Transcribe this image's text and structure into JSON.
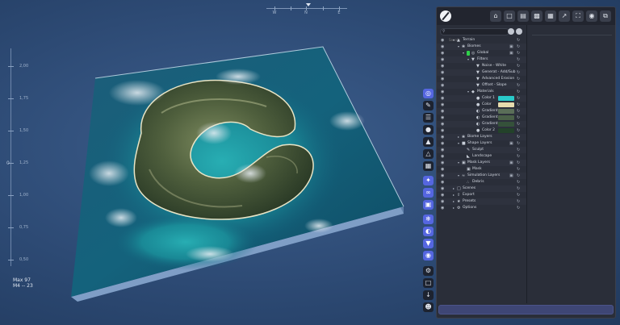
{
  "compass": {
    "labels": [
      "W",
      "N",
      "E"
    ]
  },
  "ruler": {
    "values": [
      "2,00",
      "1,75",
      "1,50",
      "1,25",
      "1,00",
      "0,75",
      "0,50"
    ],
    "zero_label": "0"
  },
  "readout": {
    "line1": "Max 97",
    "line2": "M4 -- 23"
  },
  "toolbar_left": {
    "icons": [
      "target-icon",
      "brush-icon",
      "layers-icon",
      "drop-icon",
      "mountain-icon",
      "terrain-icon",
      "grid-icon",
      "select-icon",
      "link-icon",
      "plugin-icon",
      "snow-icon",
      "globe-icon",
      "filter-icon",
      "database-icon",
      "gear-icon",
      "folder-icon",
      "download-icon",
      "people-icon"
    ]
  },
  "toolbar_top": {
    "icons": [
      "home-icon",
      "new-file-icon",
      "open-folder-icon",
      "save-icon",
      "save-as-icon",
      "export-icon",
      "fullscreen-icon",
      "camera-icon",
      "copy-icon"
    ]
  },
  "search": {
    "placeholder": "Search"
  },
  "tree": [
    {
      "label": "Terrain",
      "indent": 0,
      "caret": "v",
      "icon": "terrain-icon"
    },
    {
      "label": "Biomes",
      "indent": 1,
      "caret": "v",
      "icon": "biome-icon"
    },
    {
      "label": "Global",
      "indent": 2,
      "caret": "v",
      "icon": "global-icon",
      "flag": "#2fd14a"
    },
    {
      "label": "Filters",
      "indent": 3,
      "caret": "v",
      "icon": "filter-icon"
    },
    {
      "label": "Noise - White",
      "indent": 4,
      "caret": "",
      "icon": "filter-icon"
    },
    {
      "label": "Generat - Add/Sub",
      "indent": 4,
      "caret": "",
      "icon": "filter-icon"
    },
    {
      "label": "Advanced Erosion",
      "indent": 4,
      "caret": "",
      "icon": "filter-icon"
    },
    {
      "label": "Offset - Slope",
      "indent": 4,
      "caret": "",
      "icon": "filter-icon"
    },
    {
      "label": "Materials",
      "indent": 3,
      "caret": "v",
      "icon": "material-icon"
    },
    {
      "label": "Color 1",
      "indent": 4,
      "caret": "",
      "icon": "color-icon",
      "swatch": "#29c9c9"
    },
    {
      "label": "Color",
      "indent": 4,
      "caret": "",
      "icon": "color-icon",
      "swatch": "#e7dcae"
    },
    {
      "label": "Gradient",
      "indent": 4,
      "caret": "",
      "icon": "gradient-icon",
      "swatch": "#5a6e58"
    },
    {
      "label": "Gradient",
      "indent": 4,
      "caret": "",
      "icon": "gradient-icon",
      "swatch": "#4a6048"
    },
    {
      "label": "Gradient",
      "indent": 4,
      "caret": "",
      "icon": "gradient-icon",
      "swatch": "#35513a"
    },
    {
      "label": "Color 2",
      "indent": 4,
      "caret": "",
      "icon": "color-icon",
      "swatch": "#23422a"
    },
    {
      "label": "Biome Layers",
      "indent": 1,
      "caret": ">",
      "icon": "biome-icon"
    },
    {
      "label": "Shape Layers",
      "indent": 1,
      "caret": "v",
      "icon": "shape-icon"
    },
    {
      "label": "Sculpt",
      "indent": 2,
      "caret": "",
      "icon": "sculpt-icon"
    },
    {
      "label": "Landscape",
      "indent": 2,
      "caret": "",
      "icon": "landscape-icon"
    },
    {
      "label": "Mask Layers",
      "indent": 1,
      "caret": "v",
      "icon": "mask-icon"
    },
    {
      "label": "Mask",
      "indent": 2,
      "caret": "",
      "icon": "mask-icon"
    },
    {
      "label": "Simulation Layers",
      "indent": 1,
      "caret": "v",
      "icon": "simulation-icon"
    },
    {
      "label": "Debris",
      "indent": 2,
      "caret": "",
      "icon": "debris-icon"
    },
    {
      "label": "Scenes",
      "indent": 0,
      "caret": ">",
      "icon": "scene-icon"
    },
    {
      "label": "Export",
      "indent": 0,
      "caret": ">",
      "icon": "export-icon"
    },
    {
      "label": "Presets",
      "indent": 0,
      "caret": ">",
      "icon": "preset-icon"
    },
    {
      "label": "Options",
      "indent": 0,
      "caret": ">",
      "icon": "gear-icon"
    }
  ],
  "colors": {
    "panel_bg": "#2a2e39",
    "accent_blue": "#5566e0",
    "global_flag": "#2fd14a"
  }
}
